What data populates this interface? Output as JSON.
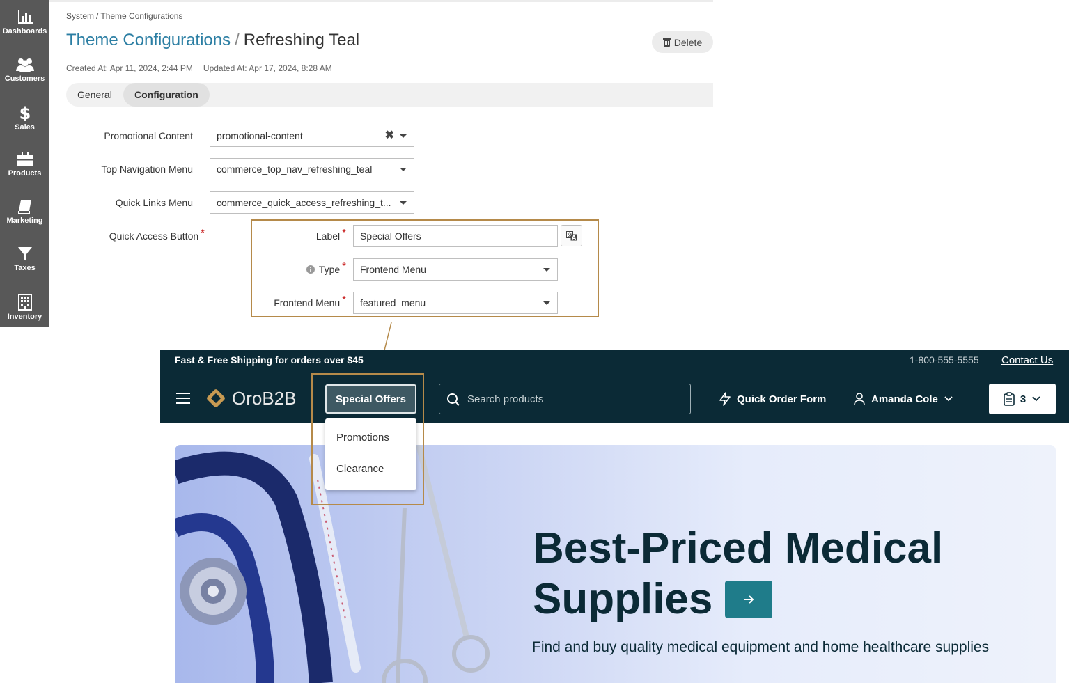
{
  "sidebar": {
    "items": [
      {
        "label": "Dashboards",
        "icon": "bar-chart-icon"
      },
      {
        "label": "Customers",
        "icon": "users-icon"
      },
      {
        "label": "Sales",
        "icon": "dollar-icon"
      },
      {
        "label": "Products",
        "icon": "briefcase-icon"
      },
      {
        "label": "Marketing",
        "icon": "book-icon"
      },
      {
        "label": "Taxes",
        "icon": "filter-icon"
      },
      {
        "label": "Inventory",
        "icon": "building-icon"
      }
    ]
  },
  "breadcrumb": {
    "first": "System",
    "separator": "/",
    "second": "Theme Configurations"
  },
  "title": {
    "link": "Theme Configurations",
    "separator": "/",
    "name": "Refreshing Teal"
  },
  "delete_label": "Delete",
  "meta": {
    "created": "Created At: Apr 11, 2024, 2:44 PM",
    "updated": "Updated At: Apr 17, 2024, 8:28 AM"
  },
  "tabs": [
    {
      "label": "General"
    },
    {
      "label": "Configuration"
    }
  ],
  "form": {
    "promotional_content": {
      "label": "Promotional Content",
      "value": "promotional-content"
    },
    "top_nav": {
      "label": "Top Navigation Menu",
      "value": "commerce_top_nav_refreshing_teal"
    },
    "quick_links": {
      "label": "Quick Links Menu",
      "value": "commerce_quick_access_refreshing_t..."
    },
    "quick_access": {
      "label": "Quick Access Button",
      "label_field": {
        "label": "Label",
        "value": "Special Offers"
      },
      "type_field": {
        "label": "Type",
        "value": "Frontend Menu"
      },
      "menu_field": {
        "label": "Frontend Menu",
        "value": "featured_menu"
      }
    },
    "required_mark": "*"
  },
  "storefront": {
    "promo": "Fast & Free Shipping for orders over $45",
    "phone": "1-800-555-5555",
    "contact": "Contact Us",
    "logo": "OroB2B",
    "special_offers": "Special Offers",
    "search_placeholder": "Search products",
    "quick_order": "Quick Order Form",
    "user": "Amanda Cole",
    "cart_count": "3",
    "dropdown": [
      "Promotions",
      "Clearance"
    ],
    "hero_title_1": "Best-Priced Medical",
    "hero_title_2": "Supplies",
    "hero_sub": "Find and buy quality medical equipment and home healthcare supplies"
  },
  "colors": {
    "accent": "#2b7ea3",
    "highlight": "#b58a4a",
    "store_dark": "#0b2a36",
    "teal": "#1f7c8a",
    "required": "#c81e1e"
  }
}
